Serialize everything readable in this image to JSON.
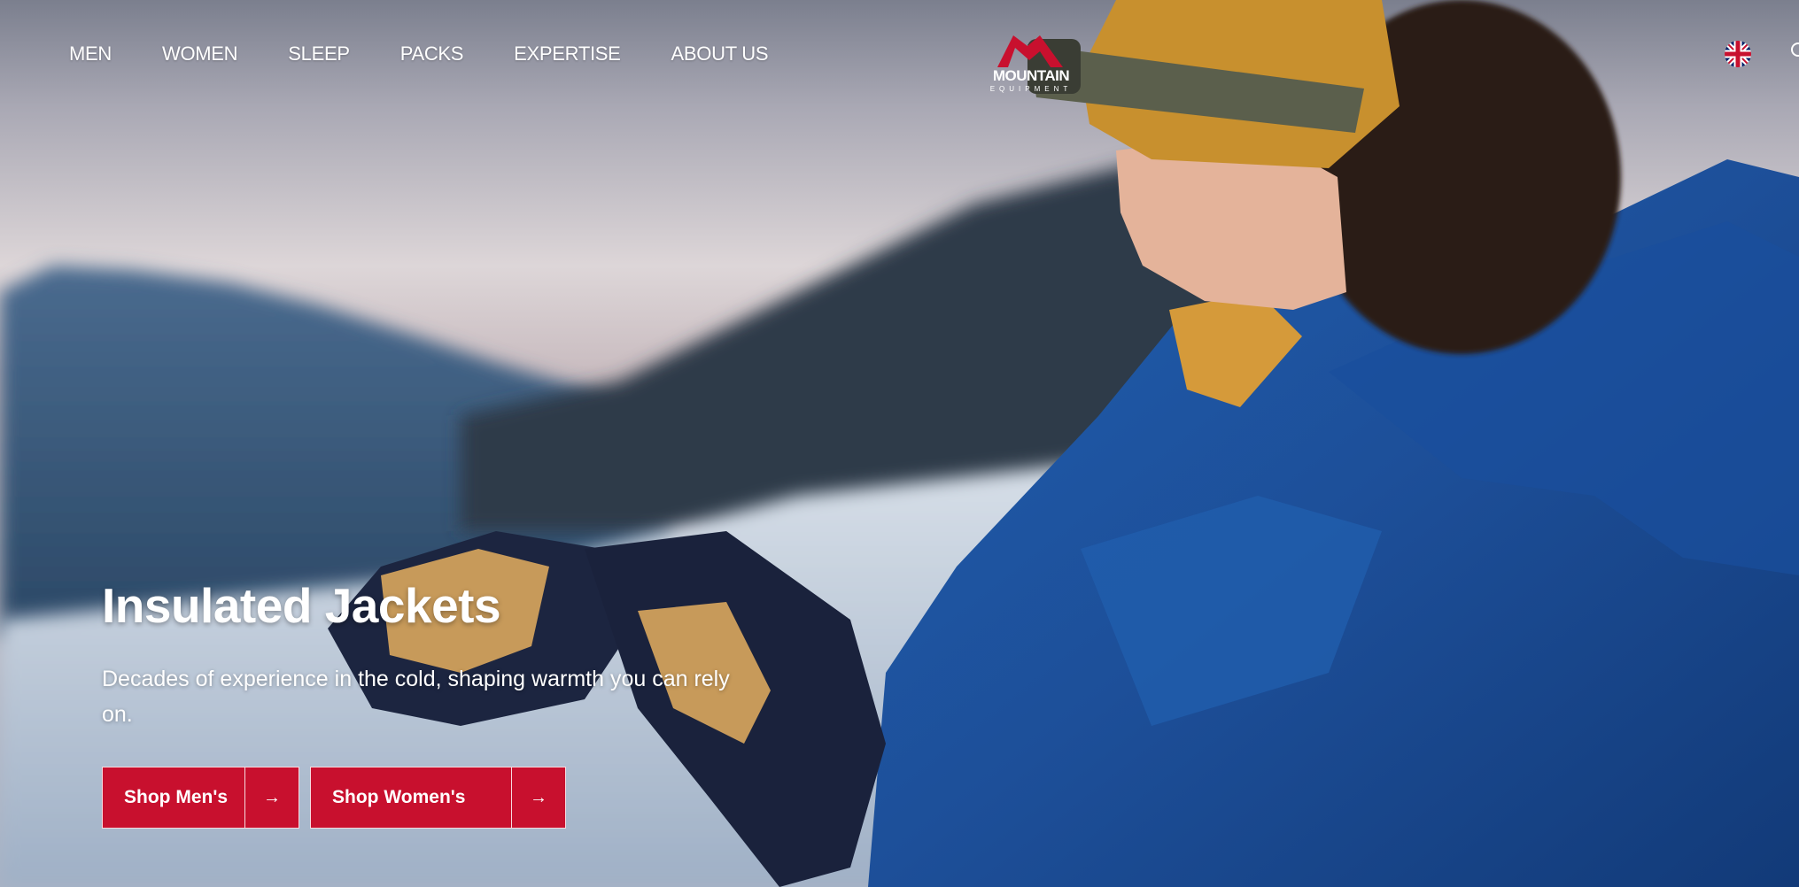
{
  "nav": {
    "items": [
      {
        "label": "MEN"
      },
      {
        "label": "WOMEN"
      },
      {
        "label": "SLEEP"
      },
      {
        "label": "PACKS"
      },
      {
        "label": "EXPERTISE"
      },
      {
        "label": "ABOUT US"
      }
    ]
  },
  "brand": {
    "name": "MOUNTAIN",
    "sub": "EQUIPMENT",
    "logo_color": "#c8102e",
    "locale_icon": "uk-flag-icon",
    "search_icon": "search-icon"
  },
  "hero": {
    "title": "Insulated Jackets",
    "subtitle": "Decades of experience in the cold, shaping warmth you can rely on.",
    "image": "woman-in-blue-down-jacket-headlamp-gloves-snow",
    "buttons": [
      {
        "label": "Shop Men's",
        "icon": "arrow-right-icon"
      },
      {
        "label": "Shop Women's",
        "icon": "arrow-right-icon"
      }
    ],
    "accent": "#c8102e"
  }
}
